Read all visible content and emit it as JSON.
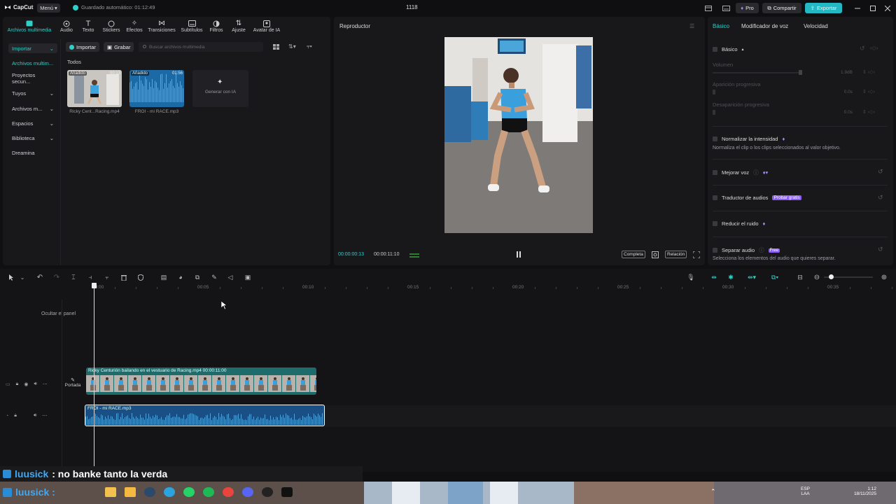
{
  "titlebar": {
    "app_name": "CapCut",
    "menu_label": "Menú",
    "autosave": "Guardado automático: 01:12:49",
    "project_name": "1118",
    "pro_label": "Pro",
    "share_label": "Compartir",
    "export_label": "Exportar"
  },
  "toolbar_tabs": [
    {
      "label": "Archivos multimedia",
      "icon": "media-icon"
    },
    {
      "label": "Audio",
      "icon": "audio-icon"
    },
    {
      "label": "Texto",
      "icon": "text-icon"
    },
    {
      "label": "Stickers",
      "icon": "sticker-icon"
    },
    {
      "label": "Efectos",
      "icon": "effects-icon"
    },
    {
      "label": "Transiciones",
      "icon": "transitions-icon"
    },
    {
      "label": "Subtítulos",
      "icon": "subtitles-icon"
    },
    {
      "label": "Filtros",
      "icon": "filters-icon"
    },
    {
      "label": "Ajuste",
      "icon": "adjust-icon"
    },
    {
      "label": "Avatar de IA",
      "icon": "ai-avatar-icon"
    }
  ],
  "side_nav": {
    "import": "Importar",
    "media_files": "Archivos multim...",
    "secure_projects": "Proyectos secun...",
    "yours": "Tuyos",
    "media_more": "Archivos m...",
    "spaces": "Espacios",
    "library": "Biblioteca",
    "dreamina": "Dreamina"
  },
  "media_toolbar": {
    "import_label": "Importar",
    "record_label": "Grabar",
    "search_placeholder": "Buscar archivos multimedia"
  },
  "media": {
    "section": "Todos",
    "items": [
      {
        "badge": "Añadido",
        "duration": "00:13",
        "name": "Ricky Cent...Racing.mp4"
      },
      {
        "badge": "Añadido",
        "duration": "01:56",
        "name": "FROI - mi RACE.mp3"
      }
    ],
    "ai_generate": "Generar con IA"
  },
  "player": {
    "title": "Reproductor",
    "current_time": "00:00:00:13",
    "total_time": "00:00:11:10",
    "full_label": "Completa",
    "ratio_label": "Relación"
  },
  "props": {
    "tabs": [
      "Básico",
      "Modificador de voz",
      "Velocidad"
    ],
    "basic_label": "Básico",
    "volume_label": "Volumen",
    "volume_value": "1.9dB",
    "fade_in_label": "Aparición progresiva",
    "fade_in_value": "0.0s",
    "fade_out_label": "Desaparición progresiva",
    "fade_out_value": "0.0s",
    "normalize_label": "Normalizar la intensidad",
    "normalize_desc": "Normaliza el clip o los clips seleccionados al valor objetivo.",
    "enhance_voice_label": "Mejorar voz",
    "translator_label": "Traductor de audios",
    "translator_tag": "Probar gratis",
    "reduce_noise_label": "Reducir el ruido",
    "separate_audio_label": "Separar audio",
    "separate_tag": "Free",
    "separate_desc": "Selecciona los elementos del audio que quieres separar."
  },
  "timeline": {
    "ruler": [
      "00:00",
      "00:05",
      "00:10",
      "00:15",
      "00:20",
      "00:25",
      "00:30",
      "00:35"
    ],
    "hide_panel": "Ocultar el panel",
    "cover_label": "Portada",
    "video_clip_label": "Ricky Centurión bailando en el vestuario de Racing.mp4   00:00:11:00",
    "audio_clip_label": "FROI - mi RACE.mp3"
  },
  "chat": {
    "user": "luusick",
    "message": ": no banke tanto la verda"
  },
  "taskbar": {
    "user_overlay": "luusick :",
    "lang": "ESP",
    "lang2": "LAA",
    "time": "1:12",
    "date": "18/11/2025"
  },
  "colors": {
    "accent": "#2ed0c8",
    "pro_purple": "#8b5cf6",
    "export_teal": "#22b8c4",
    "video_clip": "#1e6b6b",
    "audio_clip": "#1a4f86"
  }
}
